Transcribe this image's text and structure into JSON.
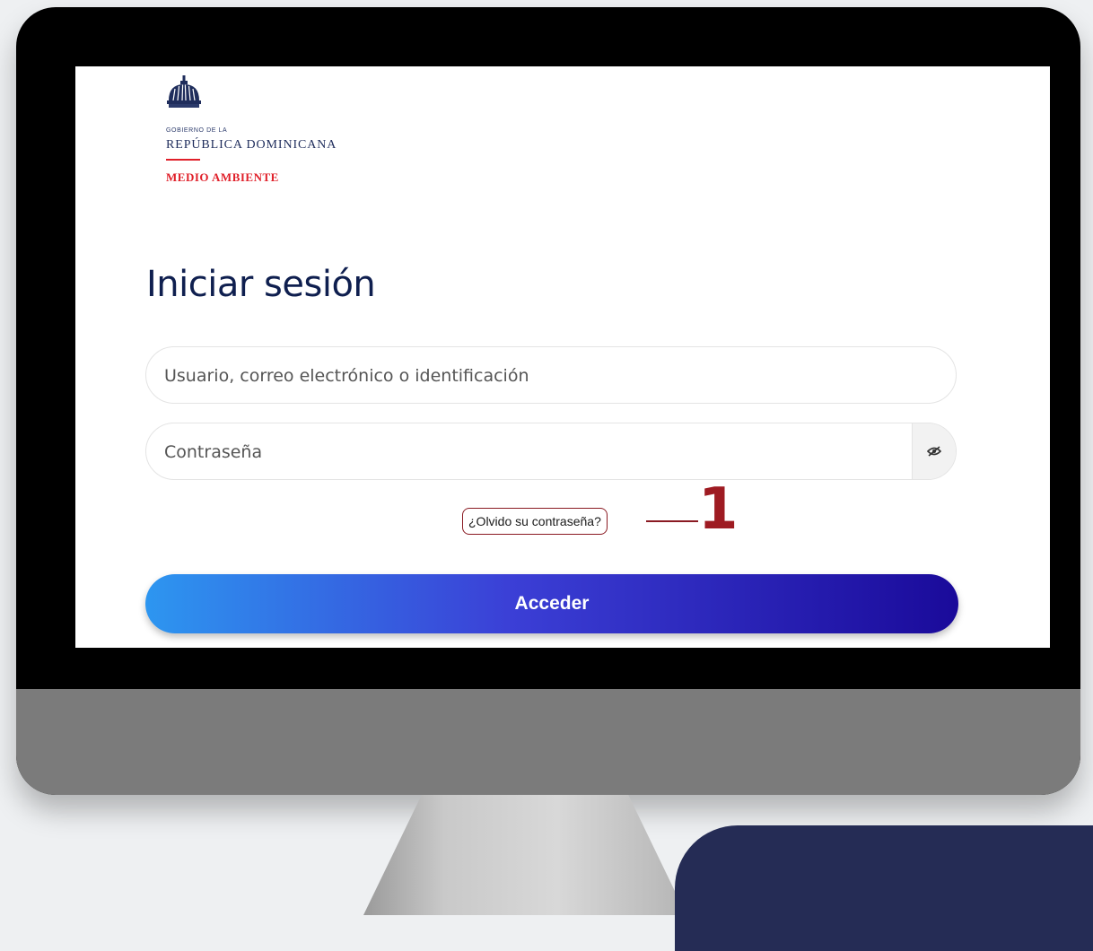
{
  "logo": {
    "line1": "GOBIERNO DE LA",
    "line2": "REPÚBLICA DOMINICANA",
    "line3": "MEDIO AMBIENTE"
  },
  "login": {
    "title": "Iniciar sesión",
    "username_placeholder": "Usuario, correo electrónico o identificación",
    "password_placeholder": "Contraseña",
    "forgot_label": "¿Olvido su contraseña?",
    "submit_label": "Acceder"
  },
  "annotation": {
    "number": "1"
  },
  "icons": {
    "logo": "dome-icon",
    "password_toggle": "eye-slash-icon"
  },
  "colors": {
    "accent_red": "#e0202a",
    "callout": "#9e1b22",
    "title": "#0f1f4f",
    "button_start": "#2d96f0",
    "button_end": "#1a0a9a"
  }
}
